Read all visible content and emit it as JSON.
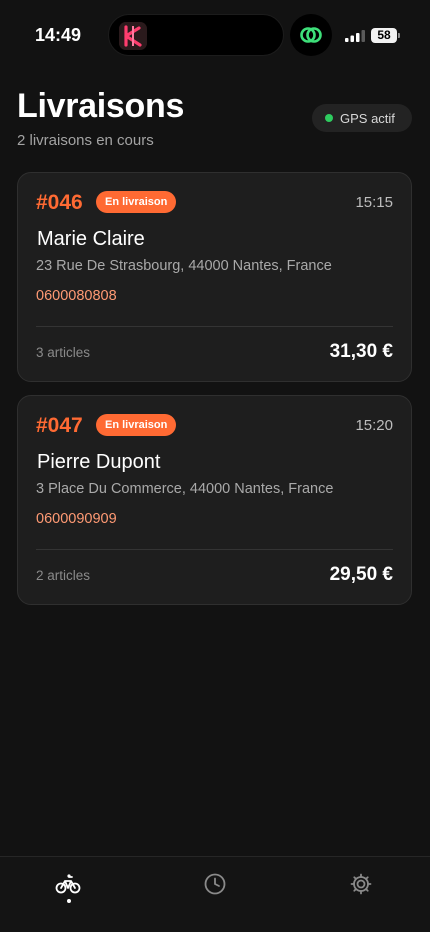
{
  "status_bar": {
    "time": "14:49",
    "battery": "58"
  },
  "header": {
    "title": "Livraisons",
    "subtitle": "2 livraisons en cours",
    "gps_label": "GPS actif",
    "gps_color": "#2ecc5f"
  },
  "colors": {
    "accent": "#ff6a33",
    "phone": "#ff9a74",
    "background": "#121212",
    "card": "#1e1e1e"
  },
  "deliveries": [
    {
      "number": "#046",
      "status": "En livraison",
      "time": "15:15",
      "name": "Marie Claire",
      "address": "23 Rue De Strasbourg, 44000 Nantes, France",
      "phone": "0600080808",
      "items": "3 articles",
      "price": "31,30 €"
    },
    {
      "number": "#047",
      "status": "En livraison",
      "time": "15:20",
      "name": "Pierre Dupont",
      "address": "3 Place Du Commerce, 44000 Nantes, France",
      "phone": "0600090909",
      "items": "2 articles",
      "price": "29,50 €"
    }
  ],
  "tabs": [
    {
      "icon": "bicycle-icon",
      "active": true
    },
    {
      "icon": "clock-icon",
      "active": false
    },
    {
      "icon": "gear-icon",
      "active": false
    }
  ]
}
